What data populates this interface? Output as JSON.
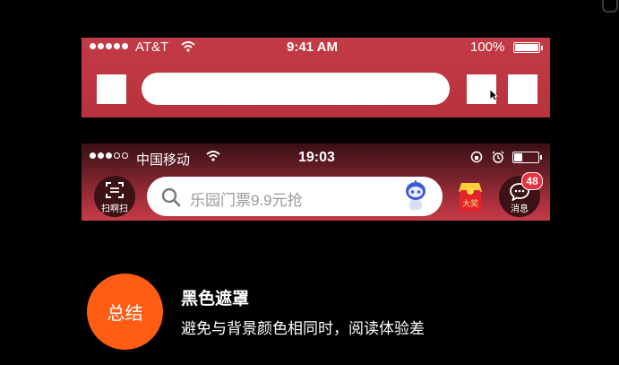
{
  "slide": {
    "badge_label": "总结",
    "title": "黑色遮罩",
    "description": "避免与背景颜色相同时，阅读体验差",
    "accent_color": "#ff5d14"
  },
  "example_top": {
    "background": "#c03a45",
    "status_bar": {
      "carrier": "AT&T",
      "time": "9:41 AM",
      "battery_percent": "100%",
      "signal_bars_filled": 5
    }
  },
  "example_bottom": {
    "status_bar": {
      "carrier": "中国移动",
      "time": "19:03",
      "signal_bars_filled": 3
    },
    "scan_label": "扫啊扫",
    "search_placeholder": "乐园门票9.9元抢",
    "red_packet_label": "大奖",
    "messages_label": "消息",
    "message_count": "48"
  }
}
